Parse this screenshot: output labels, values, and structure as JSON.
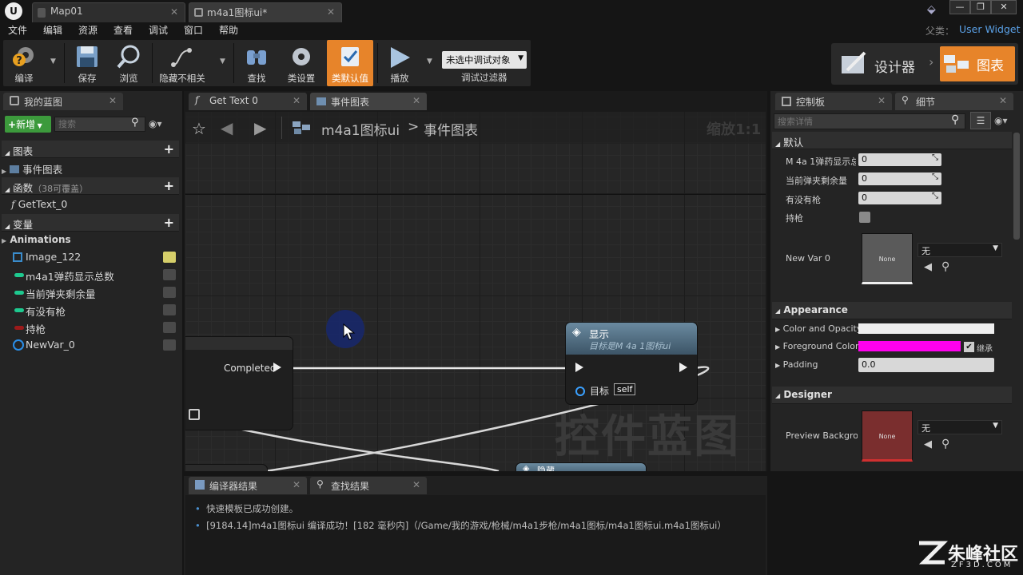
{
  "title_tabs": [
    {
      "label": "Map01"
    },
    {
      "label": "m4a1图标ui*"
    }
  ],
  "parent_class": {
    "label": "父类：",
    "value": "User Widget"
  },
  "menu": [
    "文件",
    "编辑",
    "资源",
    "查看",
    "调试",
    "窗口",
    "帮助"
  ],
  "toolbar": {
    "compile": "编译",
    "save": "保存",
    "browse": "浏览",
    "hide_unrelated": "隐藏不相关",
    "find": "查找",
    "class_settings": "类设置",
    "class_defaults": "类默认值",
    "play": "播放",
    "debug_select": "未选中调试对象",
    "debug_filter": "调试过滤器"
  },
  "modes": {
    "designer": "设计器",
    "graph": "图表"
  },
  "my_blueprint": {
    "tab": "我的蓝图",
    "new_button": "新增",
    "search_placeholder": "搜索",
    "graphs_header": "图表",
    "event_graph": "事件图表",
    "functions_header": "函数",
    "functions_note": "（38可覆盖）",
    "function_item": "GetText_0",
    "variables_header": "变量",
    "animations": "Animations",
    "variables": [
      {
        "name": "Image_122",
        "color": "#3a8ccc"
      },
      {
        "name": "m4a1弹药显示总数",
        "color": "#1ec98f"
      },
      {
        "name": "当前弹夹剩余量",
        "color": "#1ec98f"
      },
      {
        "name": "有没有枪",
        "color": "#1ec98f"
      },
      {
        "name": "持枪",
        "color": "#9c1a1a"
      },
      {
        "name": "NewVar_0",
        "color": "#2a8ee8"
      }
    ]
  },
  "graph_tabs": [
    {
      "label": "Get Text 0"
    },
    {
      "label": "事件图表"
    }
  ],
  "breadcrumb": {
    "root": "m4a1图标ui",
    "sep": ">",
    "current": "事件图表"
  },
  "zoom": "缩放1:1",
  "watermark": "控件蓝图",
  "nodes": {
    "completed_pin": "Completed",
    "show_title": "显示",
    "show_subtitle": "目标是M 4a 1图标ui",
    "target_label": "目标",
    "target_value": "self",
    "hide_title": "隐藏"
  },
  "right_tabs": {
    "palette": "控制板",
    "details": "细节"
  },
  "details": {
    "search_placeholder": "搜索详情",
    "default_header": "默认",
    "props": [
      {
        "label": "M 4a 1弹药显示总",
        "value": "0"
      },
      {
        "label": "当前弹夹剩余量",
        "value": "0"
      },
      {
        "label": "有没有枪",
        "value": "0"
      }
    ],
    "hold_gun": "持枪",
    "new_var": "New Var 0",
    "new_var_thumb": "None",
    "new_var_select": "无",
    "appearance_header": "Appearance",
    "color_opacity": "Color and Opacity",
    "foreground_color": "Foreground Color",
    "inherit": "继承",
    "padding": "Padding",
    "padding_value": "0.0",
    "designer_header": "Designer",
    "preview_bg": "Preview Backgrou",
    "preview_thumb": "None",
    "preview_select": "无",
    "fg_color": "#ff00ee",
    "preview_color": "#7a2e2e"
  },
  "output_tabs": {
    "compiler": "编译器结果",
    "find": "查找结果"
  },
  "output_lines": [
    "快速模板已成功创建。",
    "[9184.14]m4a1图标ui 编译成功！[182 毫秒内]（/Game/我的游戏/枪械/m4a1步枪/m4a1图标/m4a1图标ui.m4a1图标ui）"
  ],
  "branding": {
    "name": "朱峰社区",
    "url": "ZF3D.COM"
  }
}
